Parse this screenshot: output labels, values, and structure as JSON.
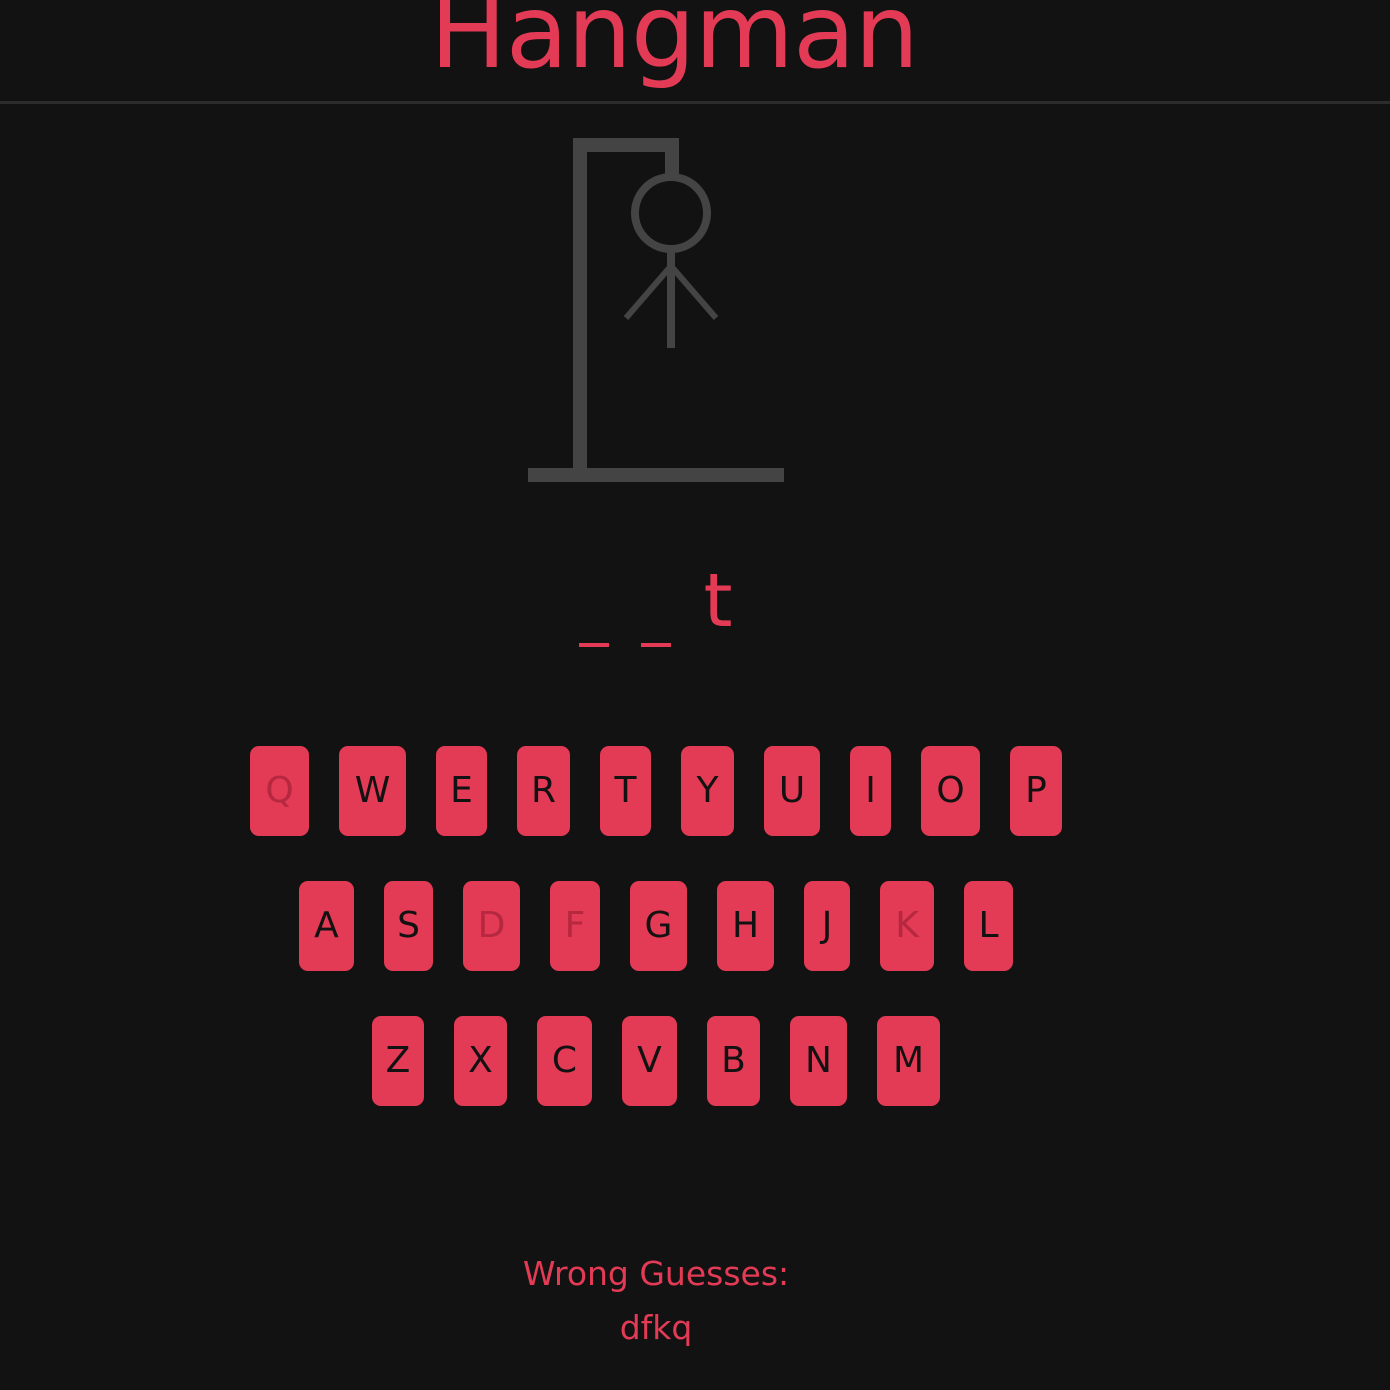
{
  "header": {
    "title": "Hangman"
  },
  "colors": {
    "background": "#121212",
    "accent": "#e33a55",
    "gallows": "#444444",
    "used_key_text": "#b5283f"
  },
  "drawing": {
    "parts_visible": [
      "base",
      "pole",
      "beam",
      "rope",
      "head",
      "body",
      "left-arm",
      "right-arm"
    ]
  },
  "word": {
    "slots": [
      {
        "letter": "",
        "revealed": false
      },
      {
        "letter": "",
        "revealed": false
      },
      {
        "letter": "t",
        "revealed": true
      }
    ]
  },
  "keyboard": {
    "rows": [
      [
        {
          "letter": "Q",
          "used": true
        },
        {
          "letter": "W",
          "used": false
        },
        {
          "letter": "E",
          "used": false
        },
        {
          "letter": "R",
          "used": false
        },
        {
          "letter": "T",
          "used": false
        },
        {
          "letter": "Y",
          "used": false
        },
        {
          "letter": "U",
          "used": false
        },
        {
          "letter": "I",
          "used": false
        },
        {
          "letter": "O",
          "used": false
        },
        {
          "letter": "P",
          "used": false
        }
      ],
      [
        {
          "letter": "A",
          "used": false
        },
        {
          "letter": "S",
          "used": false
        },
        {
          "letter": "D",
          "used": true
        },
        {
          "letter": "F",
          "used": true
        },
        {
          "letter": "G",
          "used": false
        },
        {
          "letter": "H",
          "used": false
        },
        {
          "letter": "J",
          "used": false
        },
        {
          "letter": "K",
          "used": true
        },
        {
          "letter": "L",
          "used": false
        }
      ],
      [
        {
          "letter": "Z",
          "used": false
        },
        {
          "letter": "X",
          "used": false
        },
        {
          "letter": "C",
          "used": false
        },
        {
          "letter": "V",
          "used": false
        },
        {
          "letter": "B",
          "used": false
        },
        {
          "letter": "N",
          "used": false
        },
        {
          "letter": "M",
          "used": false
        }
      ]
    ]
  },
  "wrong_guesses": {
    "label": "Wrong Guesses:",
    "value": "dfkq"
  }
}
